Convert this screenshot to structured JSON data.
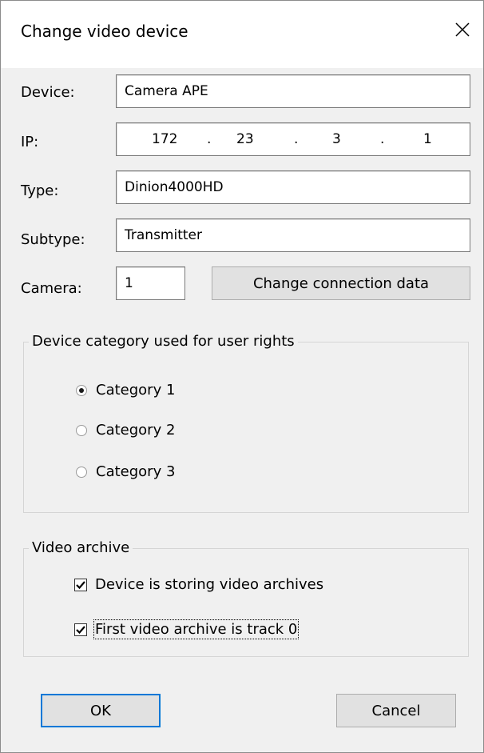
{
  "dialog": {
    "title": "Change video device"
  },
  "fields": {
    "device": {
      "label": "Device:",
      "value": "Camera APE"
    },
    "ip": {
      "label": "IP:",
      "octets": [
        "172",
        "23",
        "3",
        "1"
      ]
    },
    "type": {
      "label": "Type:",
      "value": "Dinion4000HD"
    },
    "subtype": {
      "label": "Subtype:",
      "value": "Transmitter"
    },
    "camera": {
      "label": "Camera:",
      "value": "1"
    }
  },
  "change_connection_label": "Change connection data",
  "category_group": {
    "title": "Device category used for user rights",
    "options": [
      {
        "label": "Category 1",
        "selected": true
      },
      {
        "label": "Category 2",
        "selected": false
      },
      {
        "label": "Category 3",
        "selected": false
      }
    ]
  },
  "archive_group": {
    "title": "Video archive",
    "options": [
      {
        "label": "Device is storing video archives",
        "checked": true
      },
      {
        "label": "First video archive is track 0",
        "checked": true
      }
    ]
  },
  "buttons": {
    "ok": "OK",
    "cancel": "Cancel"
  }
}
